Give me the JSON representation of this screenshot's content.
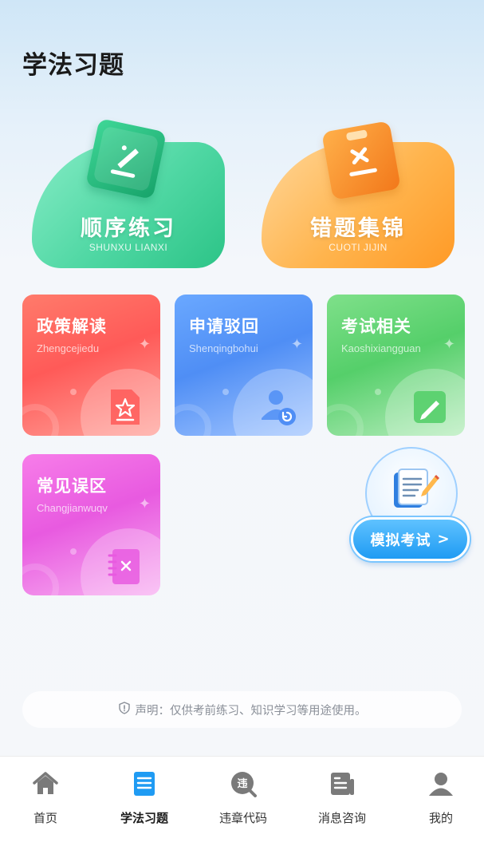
{
  "header": {
    "title": "学法习题"
  },
  "big_cards": [
    {
      "title": "顺序练习",
      "subtitle": "SHUNXU LIANXI",
      "icon": "pencil-icon"
    },
    {
      "title": "错题集锦",
      "subtitle": "CUOTI JIJIN",
      "icon": "clipboard-x-icon"
    }
  ],
  "cards": [
    {
      "title": "政策解读",
      "subtitle": "Zhengcejiedu",
      "icon": "document-star-icon"
    },
    {
      "title": "申请驳回",
      "subtitle": "Shenqingbohui",
      "icon": "user-return-icon"
    },
    {
      "title": "考试相关",
      "subtitle": "Kaoshixiangguan",
      "icon": "edit-icon"
    },
    {
      "title": "常见误区",
      "subtitle": "Changjianwuqv",
      "icon": "notebook-x-icon"
    }
  ],
  "mock_exam": {
    "label": "模拟考试",
    "arrow": ">"
  },
  "disclaimer": {
    "text": "声明：仅供考前练习、知识学习等用途使用。"
  },
  "nav": [
    {
      "label": "首页",
      "icon": "home-icon",
      "active": false
    },
    {
      "label": "学法习题",
      "icon": "book-icon",
      "active": true
    },
    {
      "label": "违章代码",
      "icon": "violation-search-icon",
      "active": false
    },
    {
      "label": "消息咨询",
      "icon": "news-icon",
      "active": false
    },
    {
      "label": "我的",
      "icon": "user-icon",
      "active": false
    }
  ],
  "colors": {
    "accent": "#1f9bf3",
    "green": "#4fd7a3",
    "orange": "#ffb44d",
    "red": "#ff5a58",
    "blue": "#4f8ef5",
    "light_green": "#55cf6a",
    "pink": "#e85ae0"
  }
}
